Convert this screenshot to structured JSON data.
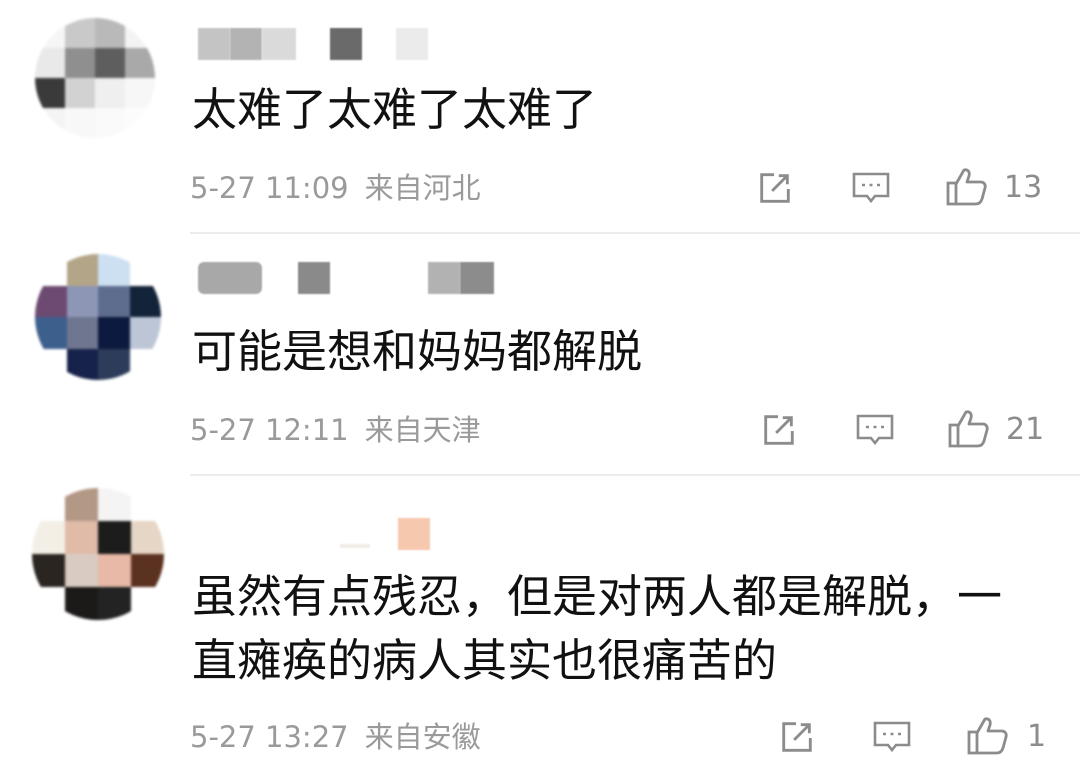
{
  "comments": [
    {
      "text": "太难了太难了太难了",
      "time": "5-27 11:09",
      "location": "来自河北",
      "likes": "13"
    },
    {
      "text": "可能是想和妈妈都解脱",
      "time": "5-27 12:11",
      "location": "来自天津",
      "likes": "21"
    },
    {
      "text": "虽然有点残忍，但是对两人都是解脱，一直瘫痪的病人其实也很痛苦的",
      "time": "5-27 13:27",
      "location": "来自安徽",
      "likes": "1"
    }
  ],
  "icons": {
    "share": "share-icon",
    "reply": "comment-icon",
    "like": "thumbs-up-icon"
  },
  "colors": {
    "text": "#111111",
    "meta": "#9a9a9a",
    "icon": "#8c8c8c",
    "divider": "#ececec"
  }
}
